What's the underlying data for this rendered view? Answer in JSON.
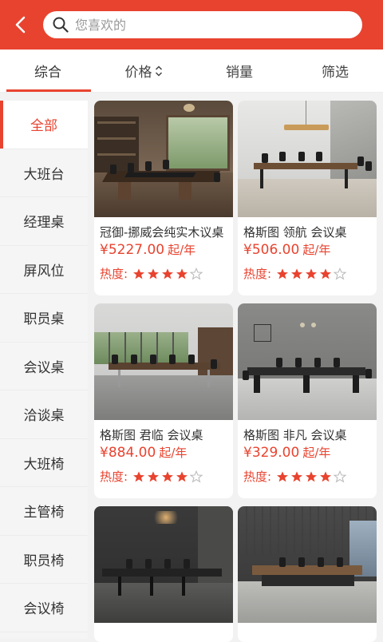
{
  "search": {
    "placeholder": "您喜欢的"
  },
  "tabs": [
    {
      "label": "综合"
    },
    {
      "label": "价格"
    },
    {
      "label": "销量"
    },
    {
      "label": "筛选"
    }
  ],
  "sidebar": {
    "items": [
      {
        "label": "全部"
      },
      {
        "label": "大班台"
      },
      {
        "label": "经理桌"
      },
      {
        "label": "屏风位"
      },
      {
        "label": "职员桌"
      },
      {
        "label": "会议桌"
      },
      {
        "label": "洽谈桌"
      },
      {
        "label": "大班椅"
      },
      {
        "label": "主管椅"
      },
      {
        "label": "职员椅"
      },
      {
        "label": "会议椅"
      }
    ]
  },
  "products": [
    {
      "name": "冠御-挪威会纯实木议桌",
      "price": "¥5227.00",
      "unit": "起/年",
      "rating_label": "热度:",
      "rating": 4
    },
    {
      "name": "格斯图 领航 会议桌",
      "price": "¥506.00",
      "unit": "起/年",
      "rating_label": "热度:",
      "rating": 4
    },
    {
      "name": "格斯图 君临 会议桌",
      "price": "¥884.00",
      "unit": "起/年",
      "rating_label": "热度:",
      "rating": 4
    },
    {
      "name": "格斯图 非凡 会议桌",
      "price": "¥329.00",
      "unit": "起/年",
      "rating_label": "热度:",
      "rating": 4
    },
    {
      "name": "",
      "price": "",
      "unit": "",
      "rating_label": "",
      "rating": 0
    },
    {
      "name": "",
      "price": "",
      "unit": "",
      "rating_label": "",
      "rating": 0
    }
  ],
  "colors": {
    "accent": "#e8432f"
  }
}
